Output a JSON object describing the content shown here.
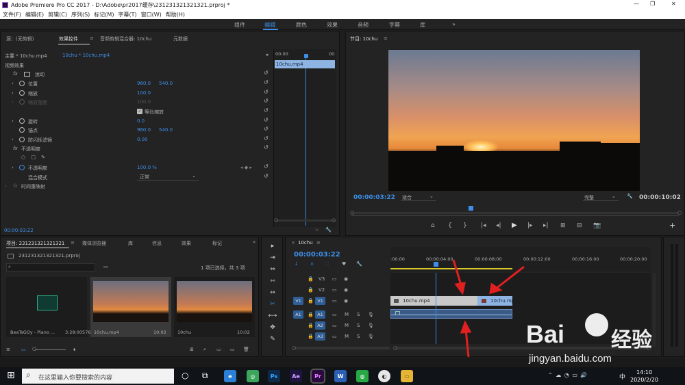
{
  "window": {
    "title": "Adobe Premiere Pro CC 2017 - D:\\Adobe\\pr2017缓存\\231231321321321.prproj *",
    "min": "—",
    "max": "❐",
    "close": "✕"
  },
  "menu": [
    "文件(F)",
    "编辑(E)",
    "剪辑(C)",
    "序列(S)",
    "标记(M)",
    "字幕(T)",
    "窗口(W)",
    "帮助(H)"
  ],
  "workspaces": [
    "组件",
    "编辑",
    "颜色",
    "效果",
    "音频",
    "字幕",
    "库"
  ],
  "workspace_more": "»",
  "effect_panel": {
    "tabs": [
      "源：(无剪辑)",
      "效果控件",
      "音频剪辑混合器: 10chu",
      "元数据"
    ],
    "tabs_menu": "≡",
    "master": "主要 * 10chu.mp4",
    "clip": "10chu * 10chu.mp4",
    "section_video": "视频效果",
    "motion": "运动",
    "position": {
      "label": "位置",
      "x": "960.0",
      "y": "540.0"
    },
    "scale": {
      "label": "缩放",
      "v": "100.0"
    },
    "scale_width": {
      "label": "缩放宽度",
      "v": "100.0"
    },
    "uniform": "等比缩放",
    "rotation": {
      "label": "旋转",
      "v": "0.0"
    },
    "anchor": {
      "label": "锚点",
      "x": "960.0",
      "y": "540.0"
    },
    "flicker": {
      "label": "防闪烁滤镜",
      "v": "0.00"
    },
    "opacity_section": "不透明度",
    "opacity": {
      "label": "不透明度",
      "v": "100.0 %"
    },
    "blend": {
      "label": "混合模式",
      "v": "正常"
    },
    "time_remap": "时间重映射",
    "time": "00:00:03:22",
    "mini_ruler": [
      "00:00",
      "00"
    ],
    "mini_clip": "10chu.mp4",
    "fx": "fx",
    "shapes": "○  □  ✎",
    "reset": "↺",
    "caret": "›",
    "keys": "◂ ◆ ▸",
    "play": "▸",
    "check": "✓",
    "dropdown": "⌄",
    "handle": "○",
    "export": "⇲",
    "wrench": "🔧"
  },
  "program": {
    "title": "节目: 10chu",
    "menu": "≡",
    "timecode": "00:00:03:22",
    "fit": "适合",
    "quality": "完整",
    "duration": "00:00:10:02",
    "wrench": "🔧",
    "buttons": [
      "⌂",
      "{",
      "}",
      "|◂",
      "◂|",
      "▶",
      "|▸",
      "▸|",
      "⊞",
      "⊟",
      "📷"
    ],
    "add": "+"
  },
  "project": {
    "tabs": [
      "项目: 231231321321321",
      "媒体浏览器",
      "库",
      "信息",
      "效果",
      "标记"
    ],
    "tabs_menu": "≡",
    "more": "»",
    "file": "231231321321321.prproj",
    "search": "",
    "bin_icon": "▭",
    "search_icon": "⌕",
    "count": "1 项已选择，共 3 项",
    "items": [
      {
        "name": "BeaTsGOy - Piano ...",
        "dur": "3:28:00576"
      },
      {
        "name": "10chu.mp4",
        "dur": "10:02"
      },
      {
        "name": "10chu",
        "dur": "10:02"
      }
    ],
    "footer_icons": [
      "≡",
      "▭",
      "○",
      "⬧",
      "⊞",
      "⌕",
      "▭",
      "▭",
      "🗑"
    ]
  },
  "tools": [
    "▸",
    "⇥",
    "⇔",
    "⇿",
    "↔",
    "✂",
    "⟷",
    "✥",
    "✎"
  ],
  "timeline": {
    "title": "10chu",
    "menu": "≡",
    "close": "×",
    "timecode": "00:00:03:22",
    "top_icons": [
      "⸸",
      "∩",
      "⸬",
      "♥",
      "🔧"
    ],
    "ruler": [
      ":00:00",
      "00:00:04:00",
      "00:00:08:00",
      "00:00:12:00",
      "00:00:16:00",
      "00:00:20:00"
    ],
    "video_tracks": [
      "V3",
      "V2",
      "V1"
    ],
    "audio_tracks": [
      "A1",
      "A2",
      "A3"
    ],
    "src_v": "V1",
    "src_a": "A1",
    "lock": "🔒",
    "toggle": "▭",
    "eye": "◉",
    "mute": "M",
    "solo": "S",
    "mic": "🎙",
    "clip1": "10chu.mp4",
    "clip2": "10chu.mp",
    "fx_badge": "fx"
  },
  "watermark": {
    "brand": "Bai",
    "brand2": "经验",
    "url": "jingyan.baidu.com"
  },
  "taskbar": {
    "search": "在这里输入你要搜索的内容",
    "time": "14:10",
    "date": "2020/2/20",
    "ime": "中",
    "start": "⊞",
    "search_icon": "⌕",
    "cortana": "○",
    "taskview": "⧉",
    "tray": "⌃  ☁  ◔  ▭  🔊",
    "apps": [
      {
        "label": "e",
        "color": "#2b7fd7"
      },
      {
        "label": "◎",
        "color": "#3aa55b"
      },
      {
        "label": "Ps",
        "color": "#0d2a4a"
      },
      {
        "label": "Ae",
        "color": "#1f1440"
      },
      {
        "label": "Pr",
        "color": "#2a0a3e"
      },
      {
        "label": "W",
        "color": "#2b5fb5"
      },
      {
        "label": "◍",
        "color": "#27a845"
      },
      {
        "label": "◐",
        "color": "#e7e7e7"
      },
      {
        "label": "▭",
        "color": "#e6b535"
      }
    ]
  }
}
